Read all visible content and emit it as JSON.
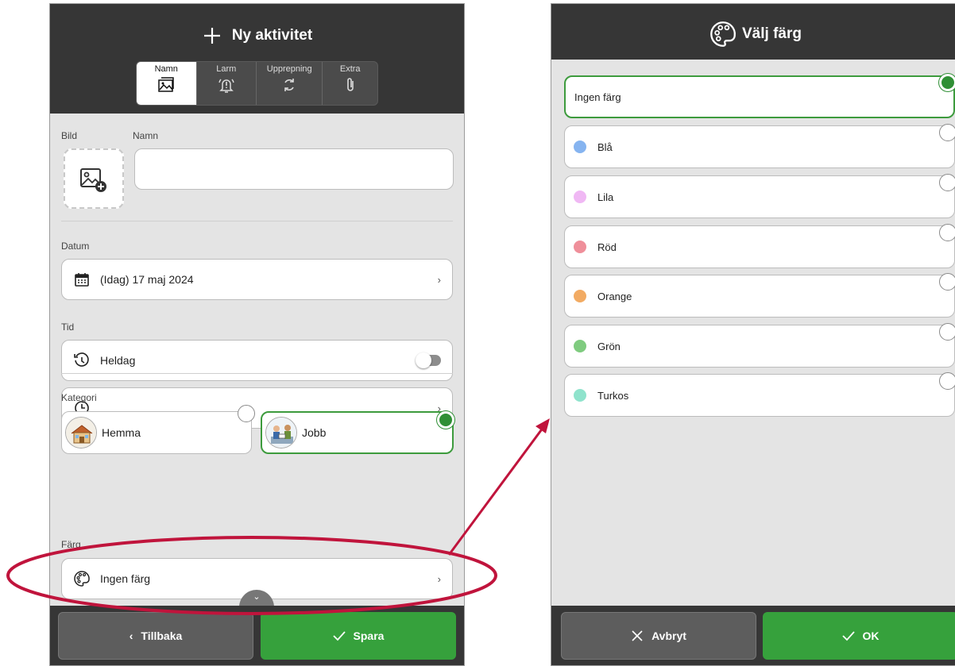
{
  "left": {
    "title": "Ny aktivitet",
    "tabs": [
      {
        "label": "Namn",
        "icon": "image-gallery-icon",
        "active": true
      },
      {
        "label": "Larm",
        "icon": "alarm-bell-icon",
        "active": false
      },
      {
        "label": "Upprepning",
        "icon": "repeat-icon",
        "active": false
      },
      {
        "label": "Extra",
        "icon": "paperclip-icon",
        "active": false
      }
    ],
    "bild_label": "Bild",
    "namn_label": "Namn",
    "namn_value": "",
    "datum_label": "Datum",
    "datum_value": "(Idag) 17 maj 2024",
    "tid_label": "Tid",
    "heldag_label": "Heldag",
    "heldag_on": false,
    "time_value": "",
    "kategori_label": "Kategori",
    "categories": [
      {
        "label": "Hemma",
        "selected": false
      },
      {
        "label": "Jobb",
        "selected": true
      }
    ],
    "farg_label": "Färg",
    "farg_value": "Ingen färg",
    "back_label": "Tillbaka",
    "save_label": "Spara"
  },
  "right": {
    "title": "Välj färg",
    "colors": [
      {
        "label": "Ingen färg",
        "color": null,
        "selected": true
      },
      {
        "label": "Blå",
        "color": "#86b4f0",
        "selected": false
      },
      {
        "label": "Lila",
        "color": "#f0b8f4",
        "selected": false
      },
      {
        "label": "Röd",
        "color": "#ef8f9a",
        "selected": false
      },
      {
        "label": "Orange",
        "color": "#f2ab63",
        "selected": false
      },
      {
        "label": "Grön",
        "color": "#7fcb7f",
        "selected": false
      },
      {
        "label": "Turkos",
        "color": "#8fe3cc",
        "selected": false
      }
    ],
    "cancel_label": "Avbryt",
    "ok_label": "OK"
  },
  "theme": {
    "bar": "#363636",
    "accent_green": "#36a13c",
    "annotation_red": "#c0143c"
  }
}
